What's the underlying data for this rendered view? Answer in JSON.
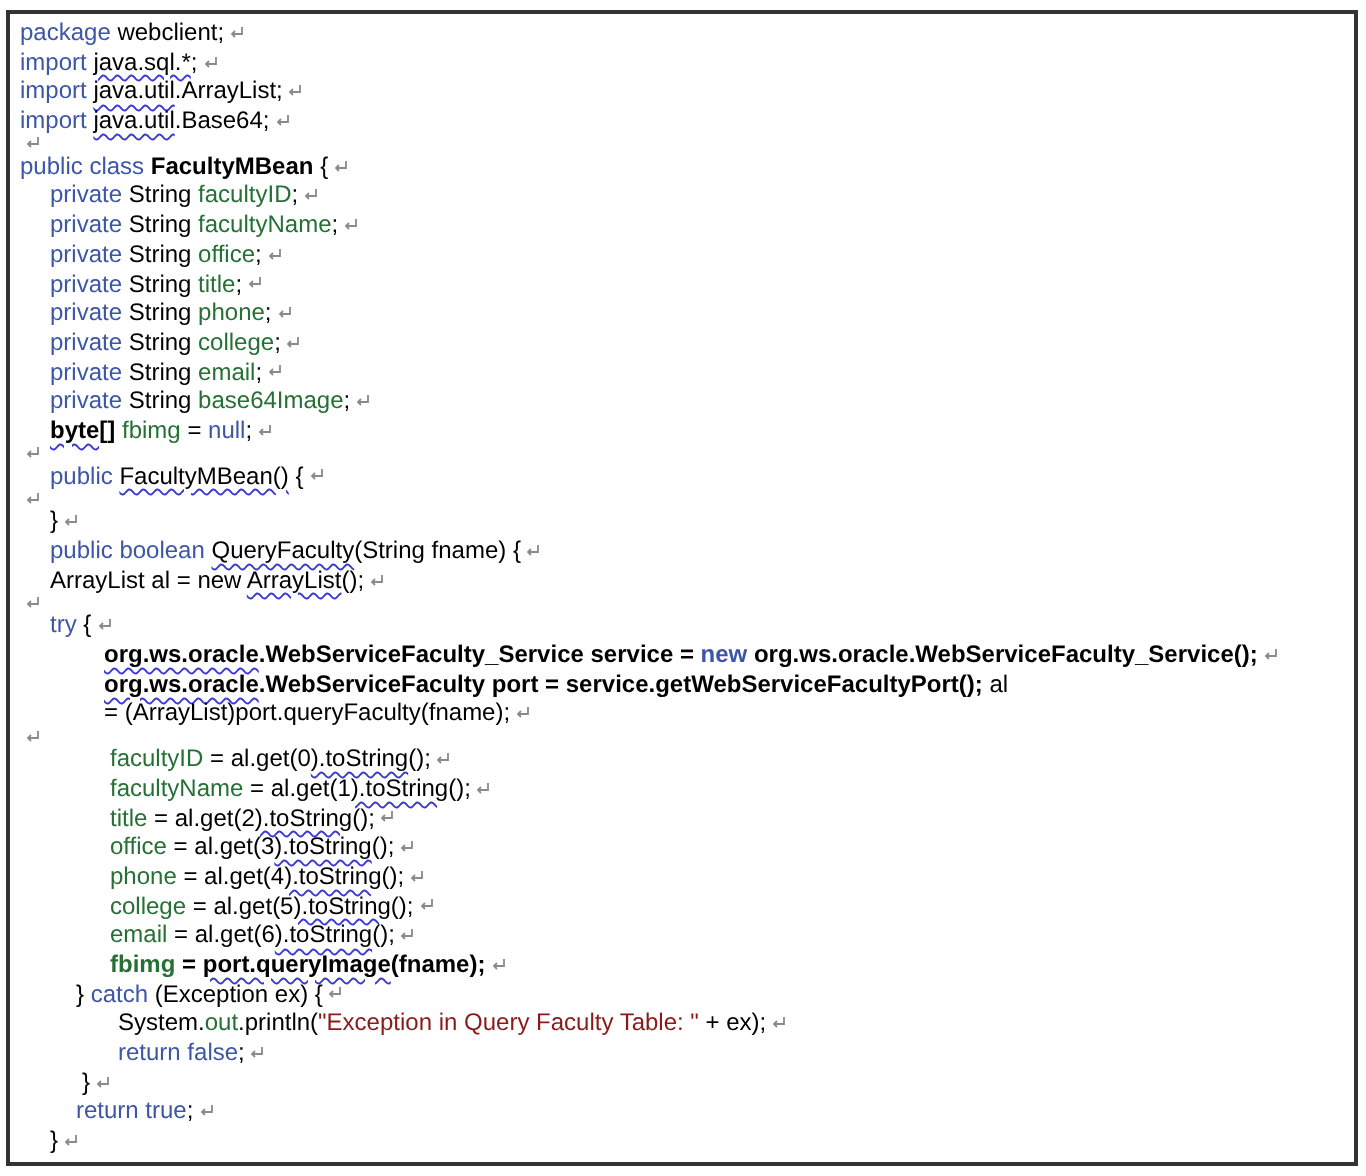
{
  "document": {
    "lines": [
      {
        "kind": "top",
        "end_mark": true,
        "tokens": [
          {
            "kind": "kw",
            "text": "package "
          },
          {
            "kind": "plain",
            "text": "webclient;"
          }
        ]
      },
      {
        "kind": "top",
        "end_mark": true,
        "tokens": [
          {
            "kind": "kw",
            "text": "import "
          },
          {
            "kind": "flagged",
            "text": "java.sql.*"
          },
          {
            "kind": "plain",
            "text": ";"
          }
        ]
      },
      {
        "kind": "top",
        "end_mark": true,
        "tokens": [
          {
            "kind": "kw",
            "text": "import "
          },
          {
            "kind": "flagged",
            "text": "java.util"
          },
          {
            "kind": "plain",
            "text": ".ArrayList;"
          }
        ]
      },
      {
        "kind": "top",
        "end_mark": true,
        "tokens": [
          {
            "kind": "kw",
            "text": "import "
          },
          {
            "kind": "flagged",
            "text": "java.util"
          },
          {
            "kind": "plain",
            "text": ".Base64;"
          }
        ]
      },
      {
        "kind": "blank",
        "end_mark": true
      },
      {
        "kind": "top",
        "end_mark": true,
        "tokens": [
          {
            "kind": "kw",
            "text": "public class "
          },
          {
            "kind": "bold",
            "text": "FacultyMBean"
          },
          {
            "kind": "plain",
            "text": " {"
          }
        ]
      },
      {
        "kind": "member",
        "end_mark": true,
        "tokens": [
          {
            "kind": "kw",
            "text": "private "
          },
          {
            "kind": "plain",
            "text": "String "
          },
          {
            "kind": "field",
            "text": "facultyID"
          },
          {
            "kind": "plain",
            "text": ";"
          }
        ]
      },
      {
        "kind": "member",
        "end_mark": true,
        "tokens": [
          {
            "kind": "kw",
            "text": "private "
          },
          {
            "kind": "plain",
            "text": "String "
          },
          {
            "kind": "field",
            "text": "facultyName"
          },
          {
            "kind": "plain",
            "text": ";"
          }
        ]
      },
      {
        "kind": "member",
        "end_mark": true,
        "tokens": [
          {
            "kind": "kw",
            "text": "private "
          },
          {
            "kind": "plain",
            "text": "String "
          },
          {
            "kind": "field",
            "text": "office"
          },
          {
            "kind": "plain",
            "text": ";"
          }
        ]
      },
      {
        "kind": "member",
        "end_mark": true,
        "tokens": [
          {
            "kind": "kw",
            "text": "private "
          },
          {
            "kind": "plain",
            "text": "String "
          },
          {
            "kind": "field",
            "text": "title"
          },
          {
            "kind": "plain",
            "text": ";"
          }
        ]
      },
      {
        "kind": "member",
        "end_mark": true,
        "tokens": [
          {
            "kind": "kw",
            "text": "private "
          },
          {
            "kind": "plain",
            "text": "String "
          },
          {
            "kind": "field",
            "text": "phone"
          },
          {
            "kind": "plain",
            "text": ";"
          }
        ]
      },
      {
        "kind": "member",
        "end_mark": true,
        "tokens": [
          {
            "kind": "kw",
            "text": "private "
          },
          {
            "kind": "plain",
            "text": "String "
          },
          {
            "kind": "field",
            "text": "college"
          },
          {
            "kind": "plain",
            "text": ";"
          }
        ]
      },
      {
        "kind": "member",
        "end_mark": true,
        "tokens": [
          {
            "kind": "kw",
            "text": "private "
          },
          {
            "kind": "plain",
            "text": "String "
          },
          {
            "kind": "field",
            "text": "email"
          },
          {
            "kind": "plain",
            "text": ";"
          }
        ]
      },
      {
        "kind": "member",
        "end_mark": true,
        "tokens": [
          {
            "kind": "kw",
            "text": "private "
          },
          {
            "kind": "plain",
            "text": "String "
          },
          {
            "kind": "field",
            "text": "base64Image"
          },
          {
            "kind": "plain",
            "text": ";"
          }
        ]
      },
      {
        "kind": "member",
        "end_mark": true,
        "tokens": [
          {
            "kind": "flagged_bold",
            "text": "byte[]"
          },
          {
            "kind": "field",
            "text": " fbimg"
          },
          {
            "kind": "plain",
            "text": " = "
          },
          {
            "kind": "kw",
            "text": "null"
          },
          {
            "kind": "plain",
            "text": ";"
          }
        ]
      },
      {
        "kind": "blank",
        "end_mark": true
      },
      {
        "kind": "member",
        "end_mark": true,
        "tokens": [
          {
            "kind": "kw",
            "text": "public "
          },
          {
            "kind": "flagged",
            "text": "FacultyMBean()"
          },
          {
            "kind": "plain",
            "text": " {"
          }
        ]
      },
      {
        "kind": "blank",
        "end_mark": true
      },
      {
        "kind": "member",
        "end_mark": true,
        "tokens": [
          {
            "kind": "plain",
            "text": "}"
          }
        ]
      },
      {
        "kind": "member",
        "end_mark": true,
        "tokens": [
          {
            "kind": "kw",
            "text": "public boolean "
          },
          {
            "kind": "flagged",
            "text": "QueryFaculty"
          },
          {
            "kind": "plain",
            "text": "(String fname) {"
          }
        ]
      },
      {
        "kind": "member",
        "end_mark": true,
        "tokens": [
          {
            "kind": "plain",
            "text": "ArrayList al = new "
          },
          {
            "kind": "flagged",
            "text": "ArrayList"
          },
          {
            "kind": "plain",
            "text": "();"
          }
        ]
      },
      {
        "kind": "blank",
        "end_mark": true
      },
      {
        "kind": "member",
        "end_mark": true,
        "tokens": [
          {
            "kind": "kw",
            "text": "try"
          },
          {
            "kind": "plain",
            "text": " {"
          }
        ]
      },
      {
        "kind": "body",
        "end_mark": true,
        "tokens": [
          {
            "kind": "flagged_bold",
            "text": "org.ws.oracle"
          },
          {
            "kind": "bold",
            "text": ".WebServiceFaculty_Service service = "
          },
          {
            "kind": "bold_kw",
            "text": "new"
          },
          {
            "kind": "bold",
            "text": " org.ws.oracle.WebServiceFaculty_Service();"
          }
        ]
      },
      {
        "kind": "body",
        "end_mark": false,
        "tokens": [
          {
            "kind": "flagged_bold",
            "text": "org.ws.oracle"
          },
          {
            "kind": "bold",
            "text": ".WebServiceFaculty port = service.getWebServiceFacultyPort();"
          },
          {
            "kind": "plain",
            "text": " al"
          }
        ]
      },
      {
        "kind": "body",
        "end_mark": true,
        "tokens": [
          {
            "kind": "plain",
            "text": "= (ArrayList)port.queryFaculty(fname);"
          }
        ]
      },
      {
        "kind": "blank",
        "end_mark": true
      },
      {
        "kind": "assign",
        "end_mark": true,
        "tokens": [
          {
            "kind": "field",
            "text": "facultyID"
          },
          {
            "kind": "plain",
            "text": " = al.get(0"
          },
          {
            "kind": "flagged",
            "text": ").toString"
          },
          {
            "kind": "plain",
            "text": "();"
          }
        ]
      },
      {
        "kind": "assign",
        "end_mark": true,
        "tokens": [
          {
            "kind": "field",
            "text": "facultyName"
          },
          {
            "kind": "plain",
            "text": " = al.get(1"
          },
          {
            "kind": "flagged",
            "text": ").toString"
          },
          {
            "kind": "plain",
            "text": "();"
          }
        ]
      },
      {
        "kind": "assign",
        "end_mark": true,
        "tokens": [
          {
            "kind": "field",
            "text": "title"
          },
          {
            "kind": "plain",
            "text": " = al.get(2"
          },
          {
            "kind": "flagged",
            "text": ").toString"
          },
          {
            "kind": "plain",
            "text": "();"
          }
        ]
      },
      {
        "kind": "assign",
        "end_mark": true,
        "tokens": [
          {
            "kind": "field",
            "text": "office"
          },
          {
            "kind": "plain",
            "text": " = al.get(3"
          },
          {
            "kind": "flagged",
            "text": ").toString"
          },
          {
            "kind": "plain",
            "text": "();"
          }
        ]
      },
      {
        "kind": "assign",
        "end_mark": true,
        "tokens": [
          {
            "kind": "field",
            "text": "phone"
          },
          {
            "kind": "plain",
            "text": " = al.get(4"
          },
          {
            "kind": "flagged",
            "text": ").toString"
          },
          {
            "kind": "plain",
            "text": "();"
          }
        ]
      },
      {
        "kind": "assign",
        "end_mark": true,
        "tokens": [
          {
            "kind": "field",
            "text": "college"
          },
          {
            "kind": "plain",
            "text": " = al.get(5"
          },
          {
            "kind": "flagged",
            "text": ").toString"
          },
          {
            "kind": "plain",
            "text": "();"
          }
        ]
      },
      {
        "kind": "assign",
        "end_mark": true,
        "tokens": [
          {
            "kind": "field",
            "text": "email"
          },
          {
            "kind": "plain",
            "text": " = al.get(6"
          },
          {
            "kind": "flagged",
            "text": ").toString"
          },
          {
            "kind": "plain",
            "text": "();"
          }
        ]
      },
      {
        "kind": "assign",
        "end_mark": true,
        "tokens": [
          {
            "kind": "bold_field",
            "text": "fbimg"
          },
          {
            "kind": "bold",
            "text": " = "
          },
          {
            "kind": "flagged_bold",
            "text": "port.queryImage"
          },
          {
            "kind": "bold",
            "text": "(fname);"
          }
        ]
      },
      {
        "kind": "catch",
        "end_mark": true,
        "tokens": [
          {
            "kind": "plain",
            "text": "} "
          },
          {
            "kind": "kw",
            "text": "catch"
          },
          {
            "kind": "plain",
            "text": " (Exception ex) {"
          }
        ]
      },
      {
        "kind": "handler",
        "end_mark": true,
        "tokens": [
          {
            "kind": "plain",
            "text": "System."
          },
          {
            "kind": "field",
            "text": "out"
          },
          {
            "kind": "plain",
            "text": ".println("
          },
          {
            "kind": "str",
            "text": "\"Exception in Query Faculty Table: \""
          },
          {
            "kind": "plain",
            "text": " + ex);"
          }
        ]
      },
      {
        "kind": "handler",
        "end_mark": true,
        "tokens": [
          {
            "kind": "kw",
            "text": "return false"
          },
          {
            "kind": "plain",
            "text": ";"
          }
        ]
      },
      {
        "kind": "close",
        "end_mark": true,
        "tokens": [
          {
            "kind": "plain",
            "text": "}"
          }
        ]
      },
      {
        "kind": "catch",
        "end_mark": true,
        "tokens": [
          {
            "kind": "kw",
            "text": "return true"
          },
          {
            "kind": "plain",
            "text": ";"
          }
        ]
      },
      {
        "kind": "member",
        "end_mark": true,
        "tokens": [
          {
            "kind": "plain",
            "text": "}"
          }
        ]
      }
    ]
  }
}
